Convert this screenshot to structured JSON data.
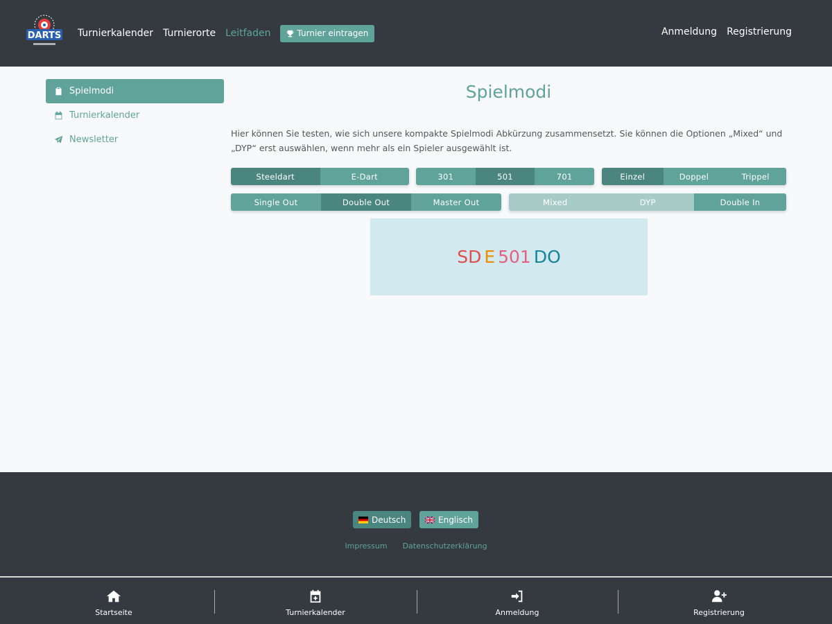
{
  "header": {
    "logo_text": "DARTS",
    "nav": [
      "Turnierkalender",
      "Turnierorte",
      "Leitfaden"
    ],
    "active_nav": "Leitfaden",
    "cta_label": "Turnier eintragen",
    "right_nav": [
      "Anmeldung",
      "Registrierung"
    ]
  },
  "sidebar": {
    "items": [
      {
        "label": "Spielmodi",
        "icon": "clipboard-icon",
        "active": true
      },
      {
        "label": "Turnierkalender",
        "icon": "calendar-icon",
        "active": false
      },
      {
        "label": "Newsletter",
        "icon": "paper-plane-icon",
        "active": false
      }
    ]
  },
  "main": {
    "title": "Spielmodi",
    "description": "Hier können Sie testen, wie sich unsere kompakte Spielmodi Abkürzung zusammensetzt. Sie können die Optionen „Mixed“ und „DYP“ erst auswählen, wenn mehr als ein Spieler ausgewählt ist.",
    "groups": {
      "type": {
        "options": [
          "Steeldart",
          "E-Dart"
        ],
        "selected": "Steeldart"
      },
      "score": {
        "options": [
          "301",
          "501",
          "701"
        ],
        "selected": "501"
      },
      "players": {
        "options": [
          "Einzel",
          "Doppel",
          "Trippel"
        ],
        "selected": "Einzel"
      },
      "out": {
        "options": [
          "Single Out",
          "Double Out",
          "Master Out"
        ],
        "selected": "Double Out"
      },
      "team": {
        "options": [
          "Mixed",
          "DYP"
        ],
        "disabled": true
      },
      "in": {
        "options": [
          "Double In"
        ],
        "selected": null
      }
    },
    "result": {
      "parts": [
        "SD",
        "E",
        "501",
        "DO"
      ],
      "colors": [
        "#e14d4d",
        "#f08c00",
        "#e5607f",
        "#158599"
      ]
    }
  },
  "footer": {
    "languages": [
      {
        "label": "Deutsch",
        "flag": "germany-flag"
      },
      {
        "label": "Englisch",
        "flag": "uk-flag"
      }
    ],
    "links": [
      "Impressum",
      "Datenschutzerklärung"
    ]
  },
  "bottom_nav": [
    {
      "label": "Startseite",
      "icon": "home-icon"
    },
    {
      "label": "Turnierkalender",
      "icon": "calendar-icon"
    },
    {
      "label": "Anmeldung",
      "icon": "sign-in-icon"
    },
    {
      "label": "Registrierung",
      "icon": "user-plus-icon"
    }
  ],
  "colors": {
    "accent": "#5fa39a",
    "accent_dark": "#4b8580",
    "header_bg": "#343a40",
    "result_bg": "#d1e9ef"
  }
}
